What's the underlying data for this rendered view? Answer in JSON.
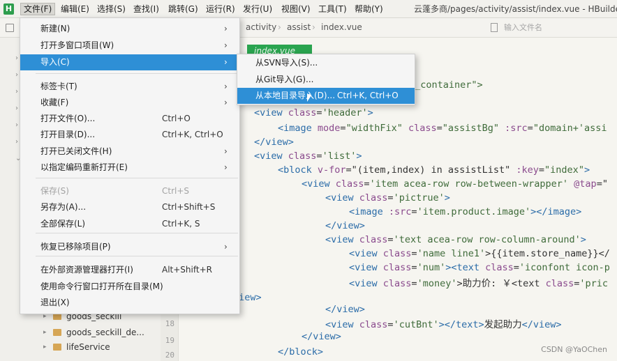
{
  "app": {
    "logo": "H",
    "window_title": "云蓬多商/pages/activity/assist/index.vue - HBuilder X"
  },
  "menubar": [
    {
      "label": "文件(F)"
    },
    {
      "label": "编辑(E)"
    },
    {
      "label": "选择(S)"
    },
    {
      "label": "查找(I)"
    },
    {
      "label": "跳转(G)"
    },
    {
      "label": "运行(R)"
    },
    {
      "label": "发行(U)"
    },
    {
      "label": "视图(V)"
    },
    {
      "label": "工具(T)"
    },
    {
      "label": "帮助(Y)"
    }
  ],
  "toolbar": {
    "breadcrumbs": [
      "activity",
      "assist",
      "index.vue"
    ],
    "file_search_placeholder": "输入文件名"
  },
  "file_menu": {
    "groups": [
      [
        {
          "label": "新建(N)",
          "shortcut": "",
          "submenu": true
        },
        {
          "label": "打开多窗口项目(W)",
          "shortcut": "",
          "submenu": true
        },
        {
          "label": "导入(C)",
          "shortcut": "",
          "submenu": true,
          "highlighted": true
        }
      ],
      [
        {
          "label": "标签卡(T)",
          "shortcut": "",
          "submenu": true
        },
        {
          "label": "收藏(F)",
          "shortcut": "",
          "submenu": true
        },
        {
          "label": "打开文件(O)...",
          "shortcut": "Ctrl+O"
        },
        {
          "label": "打开目录(D)...",
          "shortcut": "Ctrl+K, Ctrl+O"
        },
        {
          "label": "打开已关闭文件(H)",
          "shortcut": "",
          "submenu": true
        },
        {
          "label": "以指定编码重新打开(E)",
          "shortcut": "",
          "submenu": true
        }
      ],
      [
        {
          "label": "保存(S)",
          "shortcut": "Ctrl+S",
          "disabled": true
        },
        {
          "label": "另存为(A)...",
          "shortcut": "Ctrl+Shift+S"
        },
        {
          "label": "全部保存(L)",
          "shortcut": "Ctrl+K, S"
        }
      ],
      [
        {
          "label": "恢复已移除项目(P)",
          "shortcut": "",
          "submenu": true
        }
      ],
      [
        {
          "label": "在外部资源管理器打开(I)",
          "shortcut": "Alt+Shift+R"
        },
        {
          "label": "使用命令行窗口打开所在目录(M)",
          "shortcut": ""
        },
        {
          "label": "退出(X)",
          "shortcut": ""
        }
      ]
    ]
  },
  "import_submenu": [
    {
      "label": "从SVN导入(S)...",
      "shortcut": ""
    },
    {
      "label": "从Git导入(G)...",
      "shortcut": ""
    },
    {
      "label": "从本地目录导入(D)...",
      "shortcut": "Ctrl+K, Ctrl+O",
      "highlighted": true
    }
  ],
  "sidebar": {
    "items": [
      {
        "label": "goods_seckill"
      },
      {
        "label": "goods_seckill_de..."
      },
      {
        "label": "lifeService"
      }
    ]
  },
  "editor": {
    "tab": "index.vue",
    "line_numbers": [
      "17",
      "18",
      "19",
      "20"
    ],
    "lines": [
      [
        {
          "t": "e_container\">",
          "c": "str"
        }
      ],
      [
        {
          "t": "<view ",
          "c": "tag"
        },
        {
          "t": "class",
          "c": "attr"
        },
        {
          "t": "=",
          "c": "txt"
        },
        {
          "t": "'header'",
          "c": "str"
        },
        {
          "t": ">",
          "c": "tag"
        }
      ],
      [
        {
          "t": "<image ",
          "c": "tag"
        },
        {
          "t": "mode",
          "c": "attr"
        },
        {
          "t": "=",
          "c": "txt"
        },
        {
          "t": "\"widthFix\" ",
          "c": "str"
        },
        {
          "t": "class",
          "c": "attr"
        },
        {
          "t": "=",
          "c": "txt"
        },
        {
          "t": "\"assistBg\" ",
          "c": "str"
        },
        {
          "t": ":src",
          "c": "attr"
        },
        {
          "t": "=",
          "c": "txt"
        },
        {
          "t": "\"domain+'assi",
          "c": "str"
        }
      ],
      [
        {
          "t": "</view>",
          "c": "tag"
        }
      ],
      [
        {
          "t": "<view ",
          "c": "tag"
        },
        {
          "t": "class",
          "c": "attr"
        },
        {
          "t": "=",
          "c": "txt"
        },
        {
          "t": "'list'",
          "c": "str"
        },
        {
          "t": ">",
          "c": "tag"
        }
      ],
      [
        {
          "t": "<block ",
          "c": "tag"
        },
        {
          "t": "v-for",
          "c": "attr"
        },
        {
          "t": "=\"(item,index) in assistList\" ",
          "c": "txt"
        },
        {
          "t": ":key",
          "c": "attr"
        },
        {
          "t": "=",
          "c": "txt"
        },
        {
          "t": "\"index\"",
          "c": "str"
        },
        {
          "t": ">",
          "c": "tag"
        }
      ],
      [
        {
          "t": "<view ",
          "c": "tag"
        },
        {
          "t": "class",
          "c": "attr"
        },
        {
          "t": "=",
          "c": "txt"
        },
        {
          "t": "'item acea-row row-between-wrapper' ",
          "c": "str"
        },
        {
          "t": "@tap",
          "c": "attr"
        },
        {
          "t": "=\"",
          "c": "txt"
        }
      ],
      [
        {
          "t": "<view ",
          "c": "tag"
        },
        {
          "t": "class",
          "c": "attr"
        },
        {
          "t": "=",
          "c": "txt"
        },
        {
          "t": "'pictrue'",
          "c": "str"
        },
        {
          "t": ">",
          "c": "tag"
        }
      ],
      [
        {
          "t": "<image ",
          "c": "tag"
        },
        {
          "t": ":src",
          "c": "attr"
        },
        {
          "t": "=",
          "c": "txt"
        },
        {
          "t": "'item.product.image'",
          "c": "str"
        },
        {
          "t": "></image>",
          "c": "tag"
        }
      ],
      [
        {
          "t": "</view>",
          "c": "tag"
        }
      ],
      [
        {
          "t": "<view ",
          "c": "tag"
        },
        {
          "t": "class",
          "c": "attr"
        },
        {
          "t": "=",
          "c": "txt"
        },
        {
          "t": "'text acea-row row-column-around'",
          "c": "str"
        },
        {
          "t": ">",
          "c": "tag"
        }
      ],
      [
        {
          "t": "<view ",
          "c": "tag"
        },
        {
          "t": "class",
          "c": "attr"
        },
        {
          "t": "=",
          "c": "txt"
        },
        {
          "t": "'name line1'",
          "c": "str"
        },
        {
          "t": ">{{item.store_name}}</",
          "c": "txt"
        }
      ],
      [
        {
          "t": "<view ",
          "c": "tag"
        },
        {
          "t": "class",
          "c": "attr"
        },
        {
          "t": "=",
          "c": "txt"
        },
        {
          "t": "'num'",
          "c": "str"
        },
        {
          "t": "><text ",
          "c": "tag"
        },
        {
          "t": "class",
          "c": "attr"
        },
        {
          "t": "=",
          "c": "txt"
        },
        {
          "t": "'iconfont icon-p",
          "c": "str"
        }
      ],
      [
        {
          "t": "<view ",
          "c": "tag"
        },
        {
          "t": "class",
          "c": "attr"
        },
        {
          "t": "=",
          "c": "txt"
        },
        {
          "t": "'money'",
          "c": "str"
        },
        {
          "t": ">助力价: ￥<text ",
          "c": "txt"
        },
        {
          "t": "class",
          "c": "attr"
        },
        {
          "t": "=",
          "c": "txt"
        },
        {
          "t": "'pric",
          "c": "str"
        }
      ],
      [
        {
          "t": "view>",
          "c": "tag"
        }
      ],
      [
        {
          "t": "</view>",
          "c": "tag"
        }
      ],
      [
        {
          "t": "<view ",
          "c": "tag"
        },
        {
          "t": "class",
          "c": "attr"
        },
        {
          "t": "=",
          "c": "txt"
        },
        {
          "t": "'cutBnt'",
          "c": "str"
        },
        {
          "t": "></text>",
          "c": "tag"
        },
        {
          "t": "发起助力",
          "c": "txt"
        },
        {
          "t": "</view>",
          "c": "tag"
        }
      ],
      [
        {
          "t": "</view>",
          "c": "tag"
        }
      ],
      [
        {
          "t": "</block>",
          "c": "tag"
        }
      ]
    ]
  },
  "watermark": "CSDN @YaOChen",
  "colors": {
    "accent": "#2e8fd6",
    "tab": "#2aa44f"
  }
}
